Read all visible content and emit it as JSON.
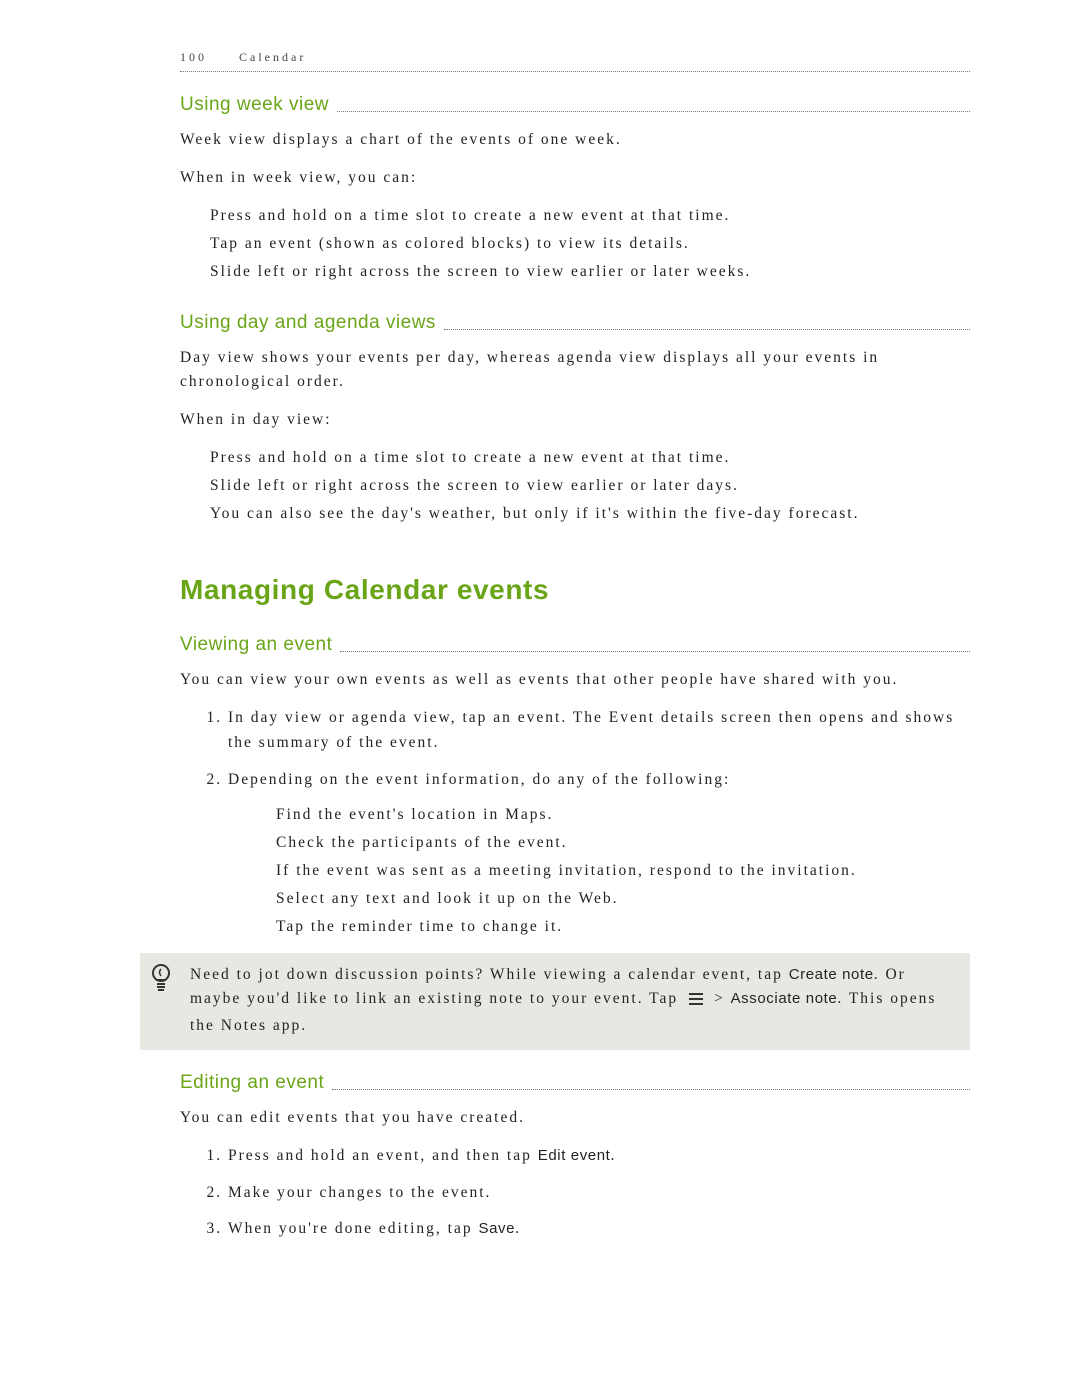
{
  "header": {
    "page_number": "100",
    "section": "Calendar"
  },
  "week": {
    "title": "Using week view",
    "intro": "Week view displays a chart of the events of one week.",
    "lead": "When in week view, you can:",
    "b1": "Press and hold on a time slot to create a new event at that time.",
    "b2": "Tap an event (shown as colored blocks) to view its details.",
    "b3": "Slide left or right across the screen to view earlier or later weeks."
  },
  "day": {
    "title": "Using day and agenda views",
    "intro": "Day view shows your events per day, whereas agenda view displays all your events in chronological order.",
    "lead": "When in day view:",
    "b1": "Press and hold on a time slot to create a new event at that time.",
    "b2": "Slide left or right across the screen to view earlier or later days.",
    "b3": "You can also see the day's weather, but only if it's within the five-day forecast."
  },
  "managing": {
    "title": "Managing Calendar events"
  },
  "viewing": {
    "title": "Viewing an event",
    "intro": "You can view your own events as well as events that other people have shared with you.",
    "s1": "In day view or agenda view, tap an event. The Event details screen then opens and shows the summary of the event.",
    "s2": "Depending on the event information, do any of the following:",
    "sub1": "Find the event's location in Maps.",
    "sub2": "Check the participants of the event.",
    "sub3": "If the event was sent as a meeting invitation, respond to the invitation.",
    "sub4": "Select any text and look it up on the Web.",
    "sub5": "Tap the reminder time to change it."
  },
  "tip": {
    "t1": "Need to jot down discussion points? While viewing a calendar event, tap ",
    "create_note": "Create note",
    "t2": ". Or maybe you'd like to link an existing note to your event. Tap ",
    "chevr": " > ",
    "assoc": "Associate note",
    "t3": ". This opens the Notes app."
  },
  "editing": {
    "title": "Editing an event",
    "intro": "You can edit events that you have created.",
    "s1a": "Press and hold an event, and then tap ",
    "s1_ui": "Edit event",
    "s1b": ".",
    "s2": "Make your changes to the event.",
    "s3a": "When you're done editing, tap ",
    "s3_ui": "Save",
    "s3b": "."
  }
}
